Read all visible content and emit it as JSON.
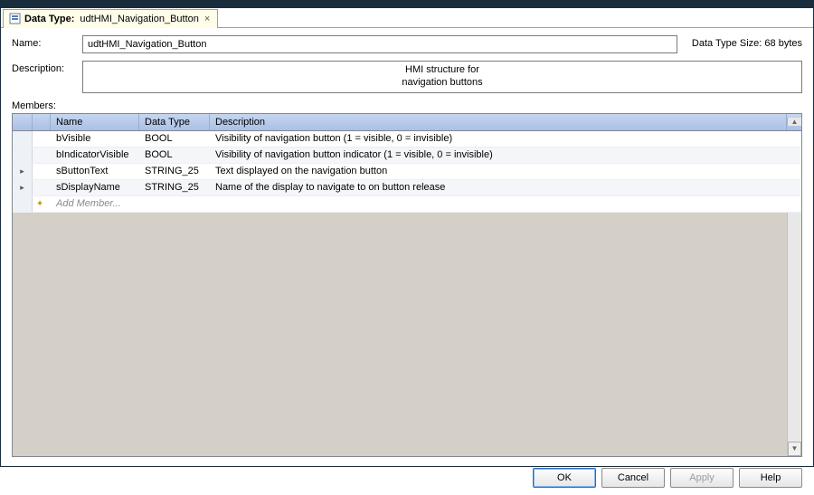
{
  "tab": {
    "prefix": "Data Type:",
    "title": "udtHMI_Navigation_Button"
  },
  "fields": {
    "name_label": "Name:",
    "name_value": "udtHMI_Navigation_Button",
    "size_label": "Data Type Size:",
    "size_value": "68 bytes",
    "desc_label": "Description:",
    "desc_value": "HMI structure for\nnavigation buttons",
    "members_label": "Members:"
  },
  "columns": {
    "name": "Name",
    "data_type": "Data Type",
    "description": "Description"
  },
  "members": [
    {
      "name": "bVisible",
      "type": "BOOL",
      "desc": "Visibility of navigation button (1 = visible, 0 = invisible)",
      "expandable": false
    },
    {
      "name": "bIndicatorVisible",
      "type": "BOOL",
      "desc": "Visibility of navigation button indicator (1 = visible, 0 = invisible)",
      "expandable": false
    },
    {
      "name": "sButtonText",
      "type": "STRING_25",
      "desc": "Text displayed on the navigation button",
      "expandable": true
    },
    {
      "name": "sDisplayName",
      "type": "STRING_25",
      "desc": "Name of the display to navigate to on button release",
      "expandable": true
    }
  ],
  "add_member_text": "Add Member...",
  "buttons": {
    "ok": "OK",
    "cancel": "Cancel",
    "apply": "Apply",
    "help": "Help"
  }
}
